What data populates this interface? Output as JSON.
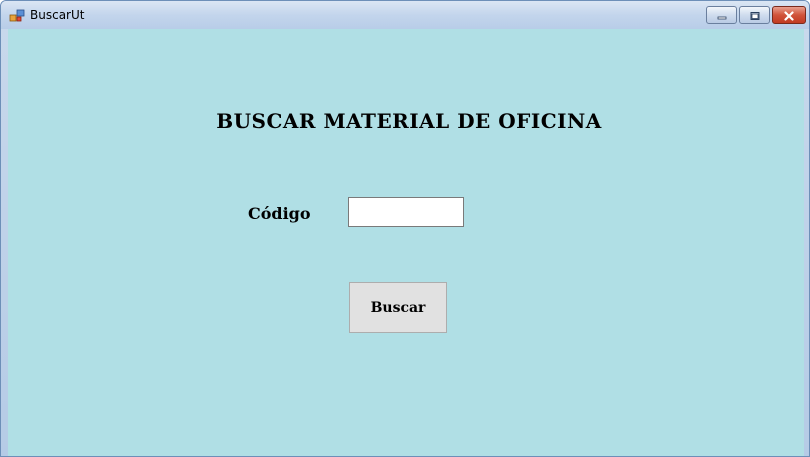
{
  "window": {
    "title": "BuscarUt",
    "app_icon": "windows-form-icon",
    "controls": {
      "minimize_icon": "minimize-icon",
      "maximize_icon": "maximize-icon",
      "close_icon": "close-icon"
    }
  },
  "form": {
    "heading": "BUSCAR MATERIAL DE OFICINA",
    "code_label": "Código",
    "code_value": "",
    "search_button_label": "Buscar"
  },
  "colors": {
    "client_background": "#b0dfe5",
    "button_background": "#e1e1e1",
    "close_button": "#c94a32"
  }
}
